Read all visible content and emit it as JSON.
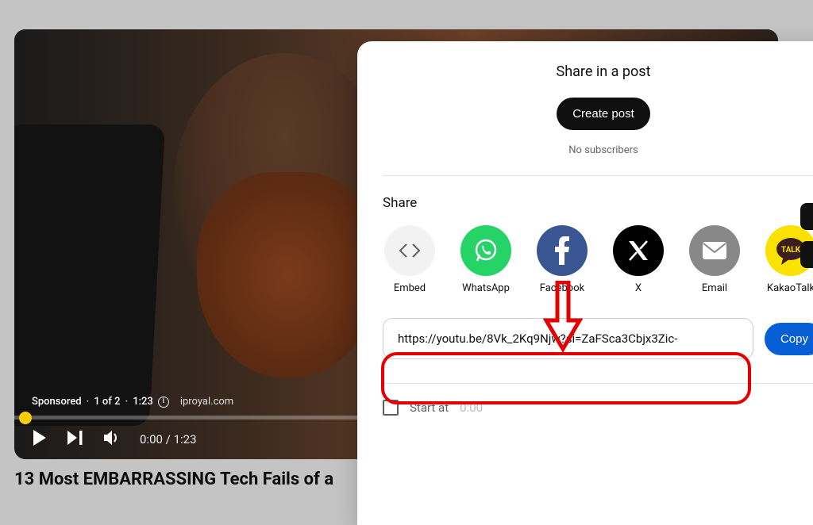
{
  "video": {
    "sponsored_label": "Sponsored",
    "ad_counter": "1 of 2",
    "ad_duration": "1:23",
    "ad_domain": "iproyal.com",
    "current_time": "0:00",
    "total_time": "1:23",
    "title": "13 Most EMBARRASSING Tech Fails of a"
  },
  "dialog": {
    "post_title": "Share in a post",
    "create_post_label": "Create post",
    "no_subscribers": "No subscribers",
    "share_heading": "Share",
    "share_options": {
      "embed": "Embed",
      "whatsapp": "WhatsApp",
      "facebook": "Facebook",
      "x": "X",
      "email": "Email",
      "kakaotalk": "KakaoTalk"
    },
    "share_url": "https://youtu.be/8Vk_2Kq9Njw?si=ZaFSca3Cbjx3Zic-",
    "copy_label": "Copy",
    "start_at_label": "Start at",
    "start_at_time": "0:00"
  },
  "colors": {
    "annotation": "#e40000",
    "primary_blue": "#065fd4"
  }
}
